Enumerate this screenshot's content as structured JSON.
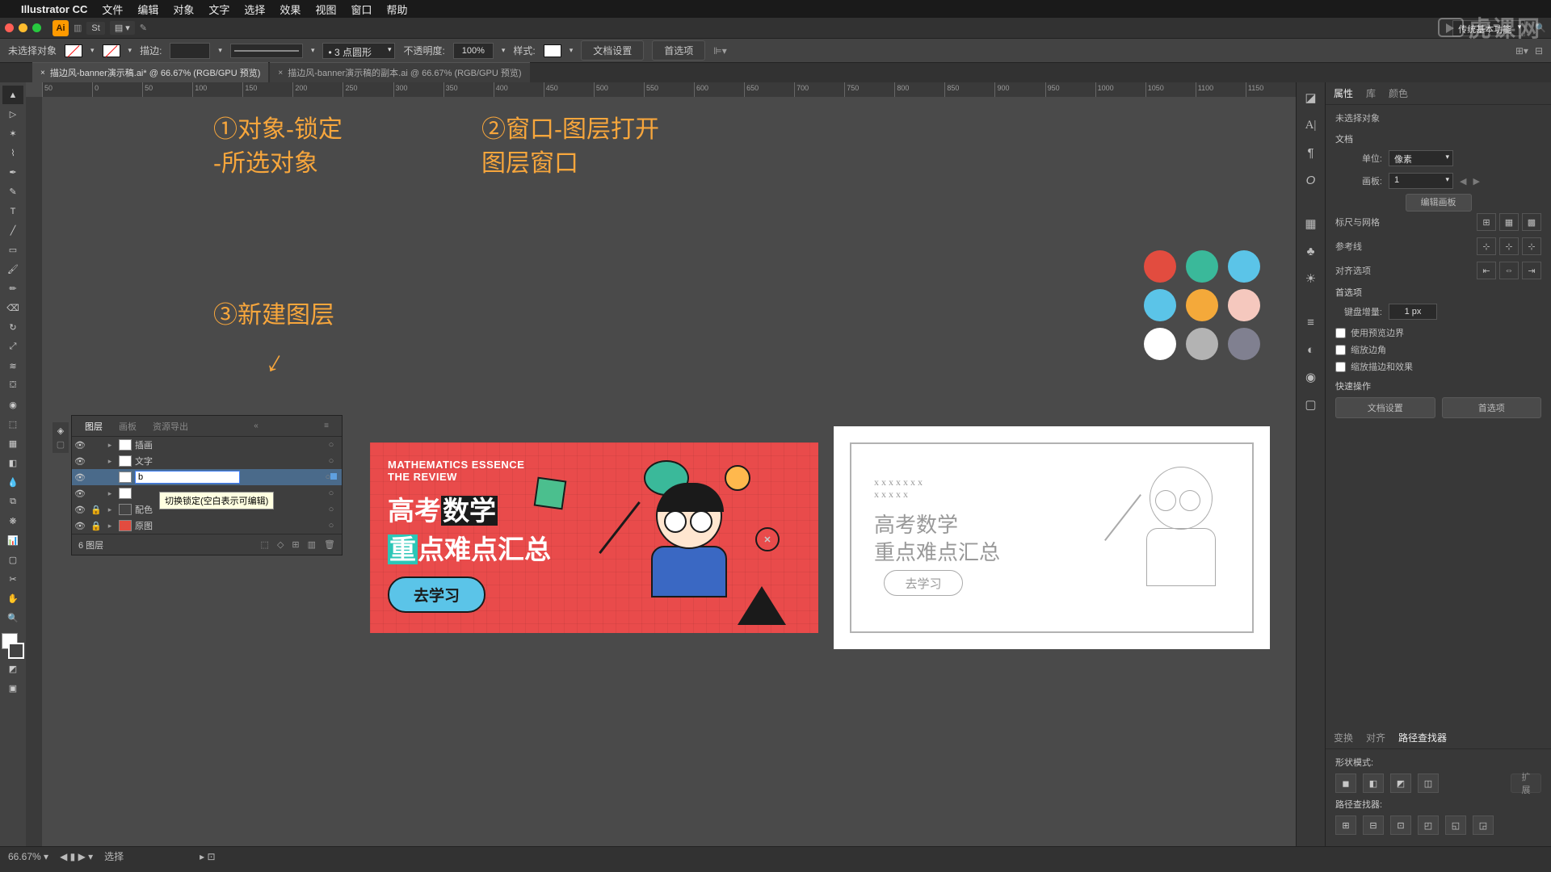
{
  "menubar": {
    "app": "Illustrator CC",
    "items": [
      "文件",
      "编辑",
      "对象",
      "文字",
      "选择",
      "效果",
      "视图",
      "窗口",
      "帮助"
    ],
    "workspace": "传统基本功能"
  },
  "optbar2": {
    "no_sel": "未选择对象",
    "stroke_label": "描边:",
    "stroke_weight": "",
    "stroke_profile": "3 点圆形",
    "opacity_label": "不透明度:",
    "opacity": "100%",
    "style_label": "样式:",
    "doc_setup": "文档设置",
    "prefs": "首选项"
  },
  "tabs": [
    {
      "label": "描边风-banner演示稿.ai* @ 66.67% (RGB/GPU 预览)",
      "active": true
    },
    {
      "label": "描边风-banner演示稿的副本.ai @ 66.67% (RGB/GPU 预览)",
      "active": false
    }
  ],
  "ruler_h": [
    "50",
    "0",
    "50",
    "100",
    "150",
    "200",
    "250",
    "300",
    "350",
    "400",
    "450",
    "500",
    "550",
    "600",
    "650",
    "700",
    "750",
    "800",
    "850",
    "900",
    "950",
    "1000",
    "1050",
    "1100",
    "1150"
  ],
  "annotations": {
    "a1_l1": "①对象-锁定",
    "a1_l2": "-所选对象",
    "a2_l1": "②窗口-图层打开",
    "a2_l2": "图层窗口",
    "a3": "③新建图层"
  },
  "palette": [
    "#e24c3f",
    "#3ab99a",
    "#5bc4e8",
    "#5bc4e8",
    "#f4a93a",
    "#f5c8be",
    "#ffffff",
    "#b3b3b3",
    "#808090"
  ],
  "artboard_a": {
    "sub1": "MATHEMATICS ESSENCE",
    "sub2": "THE REVIEW",
    "h1_pre": "高考",
    "h1_blk": "数学",
    "h2_teal": "重",
    "h2_rest": "点难点汇总",
    "btn": "去学习"
  },
  "artboard_b": {
    "t1": "高考数学",
    "t2": "重点难点汇总",
    "btn": "去学习"
  },
  "layers": {
    "tabs": [
      "图层",
      "画板",
      "资源导出"
    ],
    "rows": [
      {
        "name": "插画",
        "visible": true,
        "locked": false,
        "expand": true
      },
      {
        "name": "文字",
        "visible": true,
        "locked": false,
        "expand": true
      },
      {
        "name": "b",
        "editing": true,
        "visible": true,
        "selected": true
      },
      {
        "name": "",
        "visible": true,
        "locked": false,
        "expand": true
      },
      {
        "name": "配色",
        "visible": true,
        "locked": true,
        "expand": true,
        "sw": "#444"
      },
      {
        "name": "原图",
        "visible": true,
        "locked": true,
        "expand": true,
        "sw": "#e24c3f"
      }
    ],
    "tooltip": "切换锁定(空白表示可编辑)",
    "count": "6 图层"
  },
  "properties": {
    "tabs": [
      "属性",
      "库",
      "颜色"
    ],
    "no_sel": "未选择对象",
    "doc_section": "文档",
    "unit_label": "单位:",
    "unit": "像素",
    "artboard_label": "画板:",
    "artboard": "1",
    "edit_artboards": "编辑画板",
    "ruler_grid": "标尺与网格",
    "guides": "参考线",
    "align": "对齐选项",
    "prefs": "首选项",
    "keyinc_label": "键盘增量:",
    "keyinc": "1 px",
    "chk1": "使用预览边界",
    "chk2": "缩放边角",
    "chk3": "缩放描边和效果",
    "quick": "快速操作",
    "doc_setup": "文档设置",
    "pref_btn": "首选项"
  },
  "transform": {
    "tabs": [
      "变换",
      "对齐",
      "路径查找器"
    ],
    "shape_mode": "形状模式:",
    "expand": "扩展",
    "pathfinder": "路径查找器:"
  },
  "status": {
    "zoom": "66.67%",
    "mode": "选择"
  },
  "watermark": "虎课网"
}
